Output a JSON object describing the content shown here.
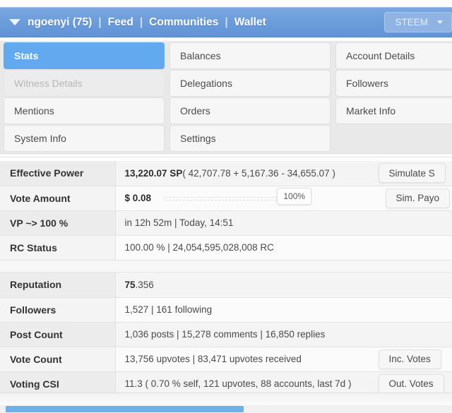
{
  "navbar": {
    "caret_icon": "caret-down-icon",
    "account": "ngoenyi (75)",
    "sep1": "|",
    "feed": "Feed",
    "sep2": "|",
    "communities": "Communities",
    "sep3": "|",
    "wallet": "Wallet",
    "currency_selector": "STEEM",
    "currency_caret_icon": "caret-down-icon",
    "bg_color": "#6d9ddb"
  },
  "tabs": [
    {
      "label": "Stats",
      "state": "active"
    },
    {
      "label": "Balances",
      "state": "normal"
    },
    {
      "label": "Account Details",
      "state": "normal"
    },
    {
      "label": "Witness Details",
      "state": "disabled"
    },
    {
      "label": "Delegations",
      "state": "normal"
    },
    {
      "label": "Followers",
      "state": "normal"
    },
    {
      "label": "Mentions",
      "state": "normal"
    },
    {
      "label": "Orders",
      "state": "normal"
    },
    {
      "label": "Market Info",
      "state": "normal"
    },
    {
      "label": "System Info",
      "state": "normal"
    },
    {
      "label": "Settings",
      "state": "normal"
    },
    {
      "label": "",
      "state": "empty"
    }
  ],
  "active_tab_color": "#62a9f0",
  "stats_top": [
    {
      "label": "Effective Power",
      "value_strong": "13,220.07 SP",
      "value_rest": " ( 42,707.78 + 5,167.36 - 34,655.07 )",
      "button": "Simulate S"
    },
    {
      "label": "Vote Amount",
      "value_strong": "$ 0.08",
      "value_rest": "",
      "slider_value": "100%",
      "button": "Sim. Payo"
    },
    {
      "label": "VP ~> 100 %",
      "value_strong": "",
      "value_rest": "in 12h 52m  |  Today, 14:51",
      "button": ""
    },
    {
      "label": "RC Status",
      "value_strong": "",
      "value_rest": "100.00 %  |  24,054,595,028,008 RC",
      "button": ""
    }
  ],
  "stats_bottom": [
    {
      "label": "Reputation",
      "value_strong": "75",
      "value_rest": ".356",
      "button": ""
    },
    {
      "label": "Followers",
      "value_strong": "",
      "value_rest": "1,527  |  161 following",
      "button": ""
    },
    {
      "label": "Post Count",
      "value_strong": "",
      "value_rest": "1,036 posts  |  15,278 comments  |  16,850 replies",
      "button": ""
    },
    {
      "label": "Vote Count",
      "value_strong": "",
      "value_rest": "13,756 upvotes  |  83,471 upvotes received",
      "button": "Inc. Votes"
    },
    {
      "label": "Voting CSI",
      "value_strong": "",
      "value_rest": "11.3 ( 0.70 % self, 121 upvotes, 88 accounts, last 7d )",
      "button": "Out. Votes"
    }
  ],
  "bottom_progress": {
    "fill_color": "#6fb0e8",
    "percent": "53"
  }
}
